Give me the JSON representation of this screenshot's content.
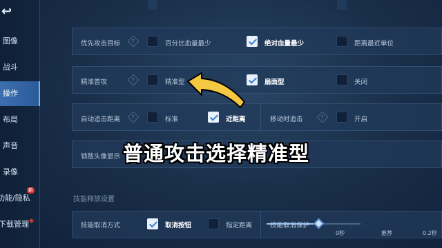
{
  "sidebar": {
    "back_label": "↩",
    "items": [
      {
        "label": "图像",
        "active": false
      },
      {
        "label": "战斗",
        "active": false
      },
      {
        "label": "操作",
        "active": true
      },
      {
        "label": "布局",
        "active": false
      },
      {
        "label": "声音",
        "active": false
      },
      {
        "label": "录像",
        "active": false
      },
      {
        "label": "功能/隐私",
        "active": false,
        "badge": "新"
      },
      {
        "label": "下载管理",
        "active": false
      }
    ]
  },
  "settings": {
    "attack_target": {
      "label": "优先攻击目标",
      "options": [
        {
          "label": "百分比血量最少",
          "checked": false
        },
        {
          "label": "绝对血量最少",
          "checked": true
        },
        {
          "label": "距离最近单位",
          "checked": false
        }
      ]
    },
    "precise_attack": {
      "label": "精准普攻",
      "options": [
        {
          "label": "精准型",
          "checked": false
        },
        {
          "label": "扇面型",
          "checked": true
        },
        {
          "label": "关闭",
          "checked": false
        }
      ]
    },
    "auto_chase": {
      "label": "自动追击距离",
      "options": [
        {
          "label": "标准",
          "checked": false
        },
        {
          "label": "近距离",
          "checked": true
        }
      ]
    },
    "move_chase": {
      "label": "移动时追击",
      "options": [
        {
          "label": "开启",
          "checked": false
        }
      ]
    },
    "lock_avatar": {
      "label": "锁敌头像显示"
    },
    "skill_section_title": "技能释放设置",
    "skill_cancel": {
      "label": "技能取消方式",
      "options": [
        {
          "label": "取消按钮",
          "checked": true
        },
        {
          "label": "指定距离",
          "checked": false
        }
      ]
    },
    "skill_protect": {
      "label": "技能取消保护",
      "slider_min_label": "0秒",
      "slider_recommend_label": "推荐",
      "slider_max_label": "0.2秒",
      "slider_fraction": 0.56
    }
  },
  "overlay": {
    "caption": "普通攻击选择精准型"
  },
  "colors": {
    "accent": "#3a7bd5",
    "arrow_fill": "#f5c842",
    "active_tab": "#3d6fb0"
  }
}
